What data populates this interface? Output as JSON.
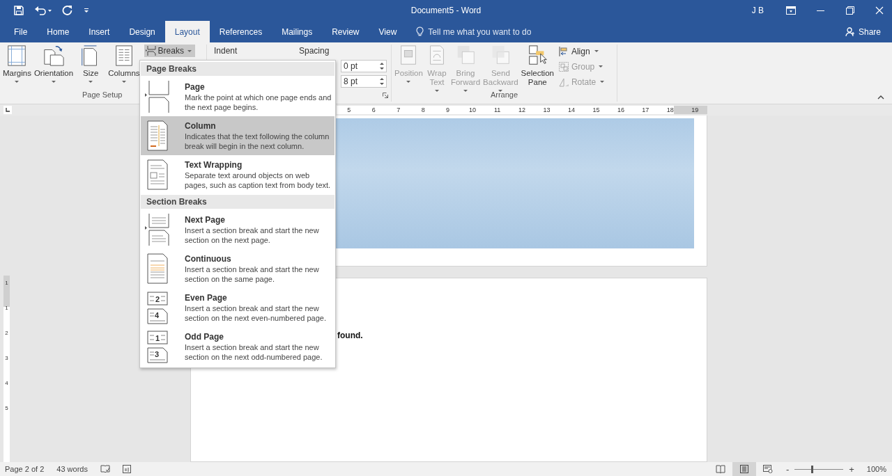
{
  "window": {
    "title": "Document5 - Word",
    "user": "J B"
  },
  "tabs": [
    {
      "label": "File",
      "selected": false
    },
    {
      "label": "Home",
      "selected": false
    },
    {
      "label": "Insert",
      "selected": false
    },
    {
      "label": "Design",
      "selected": false
    },
    {
      "label": "Layout",
      "selected": true
    },
    {
      "label": "References",
      "selected": false
    },
    {
      "label": "Mailings",
      "selected": false
    },
    {
      "label": "Review",
      "selected": false
    },
    {
      "label": "View",
      "selected": false
    }
  ],
  "tell_me": {
    "placeholder": "Tell me what you want to do"
  },
  "share": "Share",
  "page_setup": {
    "label": "Page Setup",
    "buttons": [
      {
        "kind": "margins",
        "label": [
          "Margins"
        ],
        "dropdown": true
      },
      {
        "kind": "orientation",
        "label": [
          "Orientation"
        ],
        "dropdown": true
      },
      {
        "kind": "size",
        "label": [
          "Size"
        ],
        "dropdown": true
      },
      {
        "kind": "columns",
        "label": [
          "Columns"
        ],
        "dropdown": true
      }
    ],
    "breaks": {
      "label": "Breaks",
      "expanded": true
    }
  },
  "paragraph": {
    "indent_label": "Indent",
    "spacing_label": "Spacing",
    "spacing": [
      "0 pt",
      "8 pt"
    ]
  },
  "arrange": {
    "label": "Arrange",
    "buttons": [
      {
        "kind": "position",
        "label": [
          "Position"
        ],
        "dropdown": true,
        "disabled": true
      },
      {
        "kind": "wrap",
        "label": [
          "Wrap",
          "Text"
        ],
        "dropdown": true,
        "disabled": true
      },
      {
        "kind": "bring",
        "label": [
          "Bring",
          "Forward"
        ],
        "dropdown": true,
        "disabled": true
      },
      {
        "kind": "send",
        "label": [
          "Send",
          "Backward"
        ],
        "dropdown": true,
        "disabled": true
      },
      {
        "kind": "selection",
        "label": [
          "Selection",
          "Pane"
        ],
        "dropdown": false,
        "disabled": false
      }
    ],
    "small_buttons": [
      {
        "kind": "align",
        "label": "Align",
        "disabled": false
      },
      {
        "kind": "group",
        "label": "Group",
        "disabled": true
      },
      {
        "kind": "rotate",
        "label": "Rotate",
        "disabled": true
      }
    ]
  },
  "breaks_menu": {
    "sections": [
      {
        "heading": "Page Breaks",
        "items": [
          {
            "kind": "page",
            "title": "Page",
            "description": "Mark the point at which one page ends and the next page begins.",
            "selected": false
          },
          {
            "kind": "column",
            "title": "Column",
            "description": "Indicates that the text following the column break will begin in the next column.",
            "selected": true
          },
          {
            "kind": "textwrap",
            "title": "Text Wrapping",
            "description": "Separate text around objects on web pages, such as caption text from body text.",
            "selected": false
          }
        ]
      },
      {
        "heading": "Section Breaks",
        "items": [
          {
            "kind": "nextpage",
            "title": "Next Page",
            "description": "Insert a section break and start the new section on the next page.",
            "selected": false
          },
          {
            "kind": "continuous",
            "title": "Continuous",
            "description": "Insert a section break and start the new section on the same page.",
            "selected": false
          },
          {
            "kind": "numbered",
            "title": "Even Page",
            "description": "Insert a section break and start the new section on the next even-numbered page.",
            "icon_numbers": [
              "2",
              "4"
            ],
            "selected": false
          },
          {
            "kind": "numbered",
            "title": "Odd Page",
            "description": "Insert a section break and start the new section on the next odd-numbered page.",
            "icon_numbers": [
              "1",
              "3"
            ],
            "selected": false
          }
        ]
      }
    ]
  },
  "document": {
    "ruler_numbers": [
      "5",
      "6",
      "7",
      "8",
      "9",
      "10",
      "11",
      "12",
      "13",
      "14",
      "15",
      "16",
      "17",
      "18",
      "19"
    ],
    "vertical_ruler_numbers": [
      "1",
      "1",
      "2",
      "3",
      "4",
      "5"
    ],
    "page2_text": "found."
  },
  "status_bar": {
    "page": "Page 2 of 2",
    "words": "43 words",
    "views": [
      {
        "kind": "read",
        "selected": false
      },
      {
        "kind": "print",
        "selected": true
      },
      {
        "kind": "web",
        "selected": false
      }
    ],
    "zoom_out": "-",
    "zoom_in": "+",
    "zoom": {
      "level": 0.35,
      "reading": "100%"
    }
  }
}
